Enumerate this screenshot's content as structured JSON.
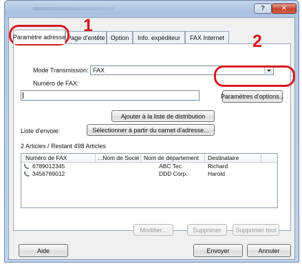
{
  "window": {
    "title_blurred": "",
    "help_glyph": "?",
    "close_glyph": "✕"
  },
  "tabs": [
    {
      "label": "Paramètre adresse",
      "active": true
    },
    {
      "label": "Page d'entête",
      "active": false
    },
    {
      "label": "Option",
      "active": false
    },
    {
      "label": "Info. expéditeur",
      "active": false
    },
    {
      "label": "FAX Internet",
      "active": false
    }
  ],
  "form": {
    "mode_label": "Mode Transmission:",
    "mode_value": "FAX",
    "fax_number_label": "Numéro de FAX:",
    "fax_number_value": "",
    "options_button": "Paramètres d'options...",
    "add_distribution_button": "Ajouter à la liste de distribution",
    "send_list_label": "Liste d'envoie:",
    "select_addressbook_button": "Sélectionner à partir du carnet d'adresse...",
    "counts": "2 Articles / Restant 498 Articles"
  },
  "list": {
    "columns": [
      "Numéro de FAX",
      "...Nom de Socié",
      "Nom de département",
      "Destinataire"
    ],
    "rows": [
      {
        "fax": "6789012345",
        "company": "",
        "department": "ABC Tec.",
        "recipient": "Richard"
      },
      {
        "fax": "3456789012",
        "company": "",
        "department": "DDD Corp.",
        "recipient": "Harold"
      }
    ]
  },
  "list_actions": {
    "modify": "Modifier...",
    "delete": "Supprimer",
    "delete_all": "Supprimer tout"
  },
  "footer": {
    "help": "Aide",
    "send": "Envoyer",
    "cancel": "Annuler"
  },
  "annotations": [
    {
      "number": "1"
    },
    {
      "number": "2"
    }
  ],
  "colors": {
    "annotation_red": "#d71920",
    "close_red": "#c2432a",
    "titlebar_blue": "#a9c1e0"
  }
}
